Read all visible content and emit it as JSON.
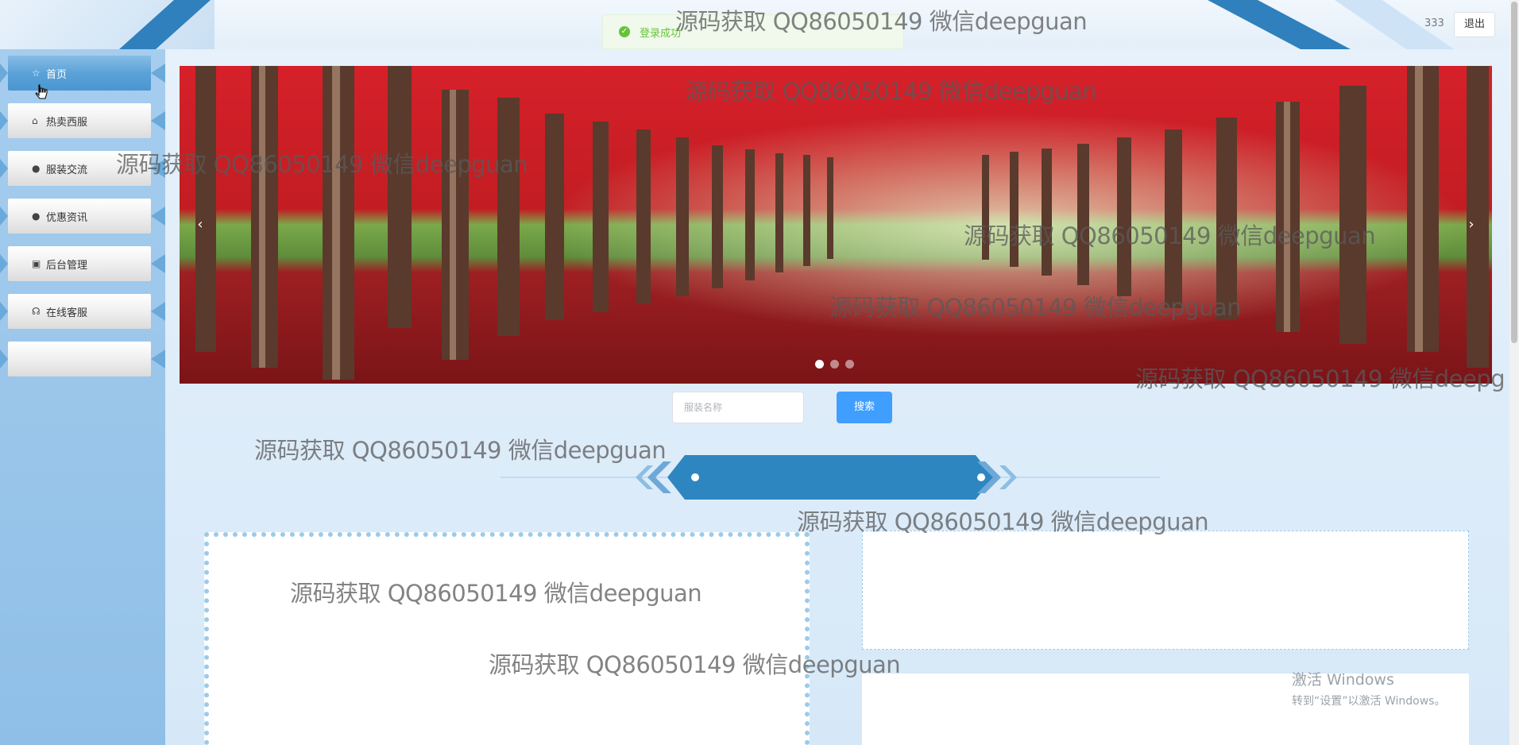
{
  "header": {
    "user_name": "333",
    "logout_label": "退出"
  },
  "toast": {
    "message": "登录成功",
    "icon": "check-circle-icon",
    "color": "#67c23a"
  },
  "sidebar": {
    "items": [
      {
        "label": "首页",
        "icon": "star-icon",
        "glyph": "☆",
        "active": true
      },
      {
        "label": "热卖西服",
        "icon": "bag-icon",
        "glyph": "⌂",
        "active": false
      },
      {
        "label": "服装交流",
        "icon": "alert-circle-icon",
        "glyph": "●",
        "active": false
      },
      {
        "label": "优惠资讯",
        "icon": "question-circle-icon",
        "glyph": "●",
        "active": false
      },
      {
        "label": "后台管理",
        "icon": "briefcase-icon",
        "glyph": "▣",
        "active": false
      },
      {
        "label": "在线客服",
        "icon": "headset-icon",
        "glyph": "☊",
        "active": false
      },
      {
        "label": "",
        "icon": "",
        "glyph": "",
        "active": false
      }
    ]
  },
  "carousel": {
    "prev_glyph": "‹",
    "next_glyph": "›",
    "slides": 3,
    "active_slide": 1
  },
  "search": {
    "placeholder": "服装名称",
    "button_label": "搜索"
  },
  "watermark": {
    "text": "源码获取 QQ86050149 微信deepguan",
    "text_cut": "源码获取 QQ86050149 微信deepg"
  },
  "windows_activation": {
    "line1": "激活 Windows",
    "line2": "转到“设置”以激活 Windows。"
  },
  "colors": {
    "accent": "#2f80bd",
    "primary_button": "#409eff"
  }
}
